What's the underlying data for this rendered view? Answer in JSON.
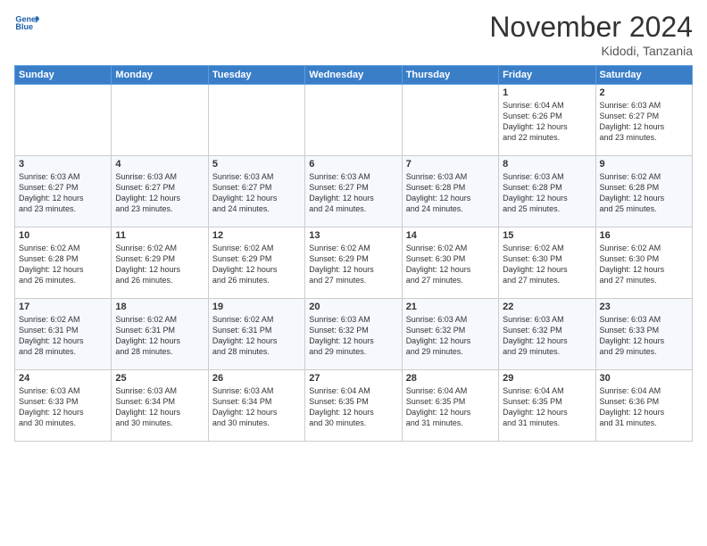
{
  "logo": {
    "line1": "General",
    "line2": "Blue"
  },
  "header": {
    "month": "November 2024",
    "location": "Kidodi, Tanzania"
  },
  "weekdays": [
    "Sunday",
    "Monday",
    "Tuesday",
    "Wednesday",
    "Thursday",
    "Friday",
    "Saturday"
  ],
  "weeks": [
    [
      {
        "day": "",
        "info": ""
      },
      {
        "day": "",
        "info": ""
      },
      {
        "day": "",
        "info": ""
      },
      {
        "day": "",
        "info": ""
      },
      {
        "day": "",
        "info": ""
      },
      {
        "day": "1",
        "info": "Sunrise: 6:04 AM\nSunset: 6:26 PM\nDaylight: 12 hours\nand 22 minutes."
      },
      {
        "day": "2",
        "info": "Sunrise: 6:03 AM\nSunset: 6:27 PM\nDaylight: 12 hours\nand 23 minutes."
      }
    ],
    [
      {
        "day": "3",
        "info": "Sunrise: 6:03 AM\nSunset: 6:27 PM\nDaylight: 12 hours\nand 23 minutes."
      },
      {
        "day": "4",
        "info": "Sunrise: 6:03 AM\nSunset: 6:27 PM\nDaylight: 12 hours\nand 23 minutes."
      },
      {
        "day": "5",
        "info": "Sunrise: 6:03 AM\nSunset: 6:27 PM\nDaylight: 12 hours\nand 24 minutes."
      },
      {
        "day": "6",
        "info": "Sunrise: 6:03 AM\nSunset: 6:27 PM\nDaylight: 12 hours\nand 24 minutes."
      },
      {
        "day": "7",
        "info": "Sunrise: 6:03 AM\nSunset: 6:28 PM\nDaylight: 12 hours\nand 24 minutes."
      },
      {
        "day": "8",
        "info": "Sunrise: 6:03 AM\nSunset: 6:28 PM\nDaylight: 12 hours\nand 25 minutes."
      },
      {
        "day": "9",
        "info": "Sunrise: 6:02 AM\nSunset: 6:28 PM\nDaylight: 12 hours\nand 25 minutes."
      }
    ],
    [
      {
        "day": "10",
        "info": "Sunrise: 6:02 AM\nSunset: 6:28 PM\nDaylight: 12 hours\nand 26 minutes."
      },
      {
        "day": "11",
        "info": "Sunrise: 6:02 AM\nSunset: 6:29 PM\nDaylight: 12 hours\nand 26 minutes."
      },
      {
        "day": "12",
        "info": "Sunrise: 6:02 AM\nSunset: 6:29 PM\nDaylight: 12 hours\nand 26 minutes."
      },
      {
        "day": "13",
        "info": "Sunrise: 6:02 AM\nSunset: 6:29 PM\nDaylight: 12 hours\nand 27 minutes."
      },
      {
        "day": "14",
        "info": "Sunrise: 6:02 AM\nSunset: 6:30 PM\nDaylight: 12 hours\nand 27 minutes."
      },
      {
        "day": "15",
        "info": "Sunrise: 6:02 AM\nSunset: 6:30 PM\nDaylight: 12 hours\nand 27 minutes."
      },
      {
        "day": "16",
        "info": "Sunrise: 6:02 AM\nSunset: 6:30 PM\nDaylight: 12 hours\nand 27 minutes."
      }
    ],
    [
      {
        "day": "17",
        "info": "Sunrise: 6:02 AM\nSunset: 6:31 PM\nDaylight: 12 hours\nand 28 minutes."
      },
      {
        "day": "18",
        "info": "Sunrise: 6:02 AM\nSunset: 6:31 PM\nDaylight: 12 hours\nand 28 minutes."
      },
      {
        "day": "19",
        "info": "Sunrise: 6:02 AM\nSunset: 6:31 PM\nDaylight: 12 hours\nand 28 minutes."
      },
      {
        "day": "20",
        "info": "Sunrise: 6:03 AM\nSunset: 6:32 PM\nDaylight: 12 hours\nand 29 minutes."
      },
      {
        "day": "21",
        "info": "Sunrise: 6:03 AM\nSunset: 6:32 PM\nDaylight: 12 hours\nand 29 minutes."
      },
      {
        "day": "22",
        "info": "Sunrise: 6:03 AM\nSunset: 6:32 PM\nDaylight: 12 hours\nand 29 minutes."
      },
      {
        "day": "23",
        "info": "Sunrise: 6:03 AM\nSunset: 6:33 PM\nDaylight: 12 hours\nand 29 minutes."
      }
    ],
    [
      {
        "day": "24",
        "info": "Sunrise: 6:03 AM\nSunset: 6:33 PM\nDaylight: 12 hours\nand 30 minutes."
      },
      {
        "day": "25",
        "info": "Sunrise: 6:03 AM\nSunset: 6:34 PM\nDaylight: 12 hours\nand 30 minutes."
      },
      {
        "day": "26",
        "info": "Sunrise: 6:03 AM\nSunset: 6:34 PM\nDaylight: 12 hours\nand 30 minutes."
      },
      {
        "day": "27",
        "info": "Sunrise: 6:04 AM\nSunset: 6:35 PM\nDaylight: 12 hours\nand 30 minutes."
      },
      {
        "day": "28",
        "info": "Sunrise: 6:04 AM\nSunset: 6:35 PM\nDaylight: 12 hours\nand 31 minutes."
      },
      {
        "day": "29",
        "info": "Sunrise: 6:04 AM\nSunset: 6:35 PM\nDaylight: 12 hours\nand 31 minutes."
      },
      {
        "day": "30",
        "info": "Sunrise: 6:04 AM\nSunset: 6:36 PM\nDaylight: 12 hours\nand 31 minutes."
      }
    ]
  ]
}
